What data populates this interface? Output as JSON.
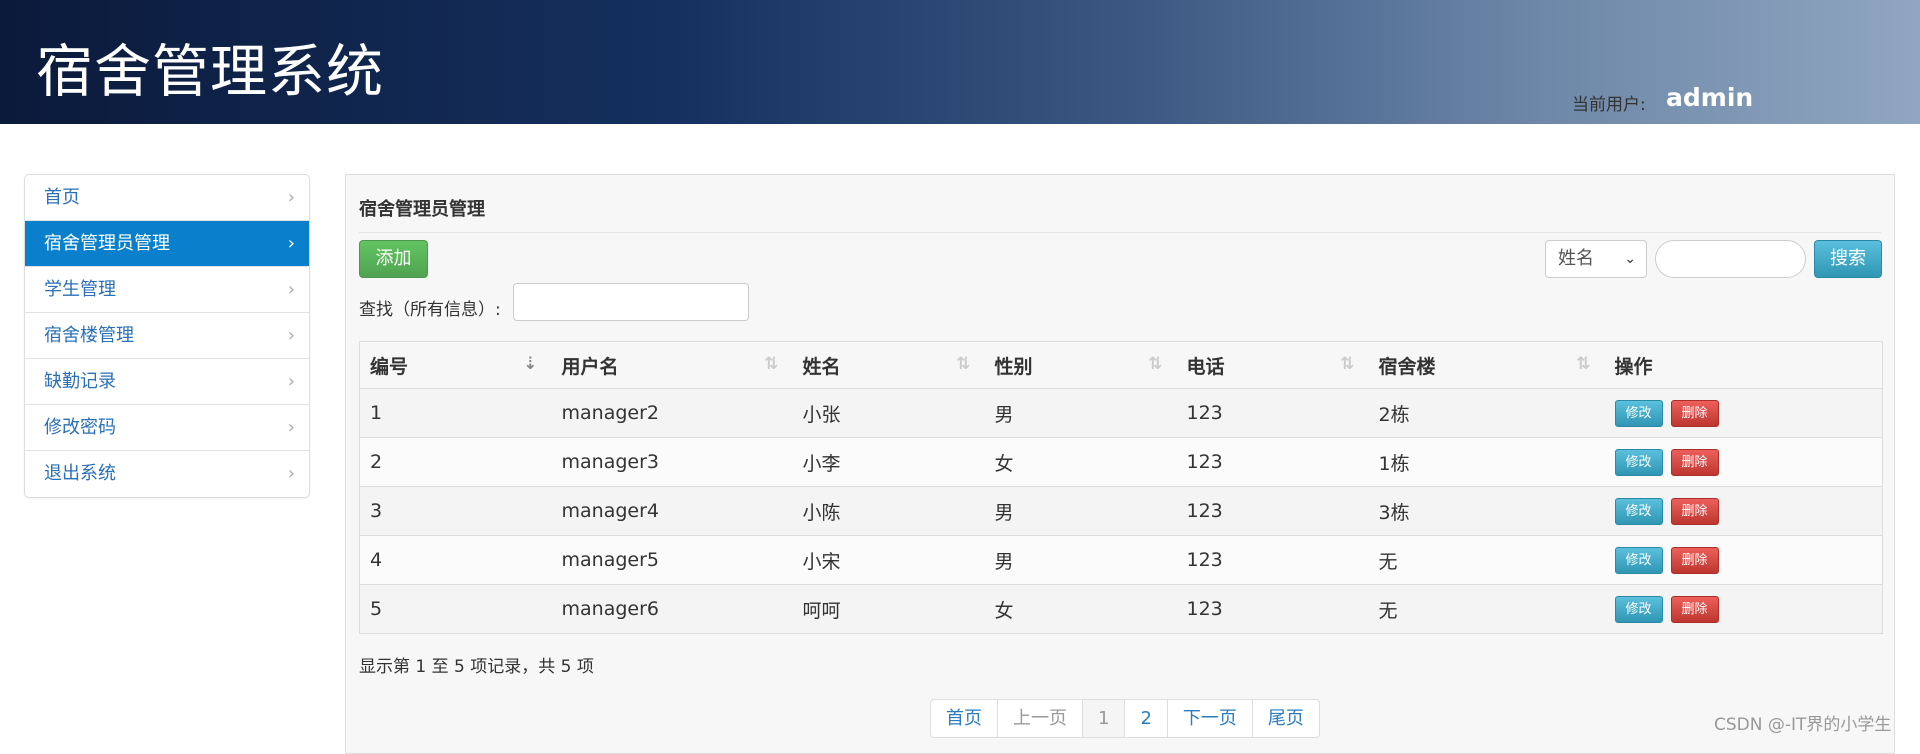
{
  "header": {
    "title": "宿舍管理系统",
    "user_label": "当前用户:",
    "user_name": "admin"
  },
  "sidebar": {
    "items": [
      {
        "label": "首页",
        "active": false
      },
      {
        "label": "宿舍管理员管理",
        "active": true
      },
      {
        "label": "学生管理",
        "active": false
      },
      {
        "label": "宿舍楼管理",
        "active": false
      },
      {
        "label": "缺勤记录",
        "active": false
      },
      {
        "label": "修改密码",
        "active": false
      },
      {
        "label": "退出系统",
        "active": false
      }
    ]
  },
  "main": {
    "title": "宿舍管理员管理",
    "add_label": "添加",
    "search_field_value": "姓名",
    "search_input_value": "",
    "search_label": "搜索",
    "find_label": "查找（所有信息）:",
    "find_input_value": "",
    "table": {
      "columns": [
        "编号",
        "用户名",
        "姓名",
        "性别",
        "电话",
        "宿舍楼",
        "操作"
      ],
      "rows": [
        [
          "1",
          "manager2",
          "小张",
          "男",
          "123",
          "2栋"
        ],
        [
          "2",
          "manager3",
          "小李",
          "女",
          "123",
          "1栋"
        ],
        [
          "3",
          "manager4",
          "小陈",
          "男",
          "123",
          "3栋"
        ],
        [
          "4",
          "manager5",
          "小宋",
          "男",
          "123",
          "无"
        ],
        [
          "5",
          "manager6",
          "呵呵",
          "女",
          "123",
          "无"
        ]
      ],
      "edit_label": "修改",
      "delete_label": "删除"
    },
    "info": "显示第 1 至 5 项记录，共 5 项",
    "pagination": {
      "first": "首页",
      "prev": "上一页",
      "pages": [
        "1",
        "2"
      ],
      "current": "1",
      "next": "下一页",
      "last": "尾页"
    }
  },
  "watermark": "CSDN @-IT界的小学生",
  "colors": {
    "active_nav": "#0a80cc",
    "link": "#2a6fb8",
    "add_button": "#5cb85c",
    "info_button": "#5bc0de",
    "danger_button": "#d9534f"
  }
}
